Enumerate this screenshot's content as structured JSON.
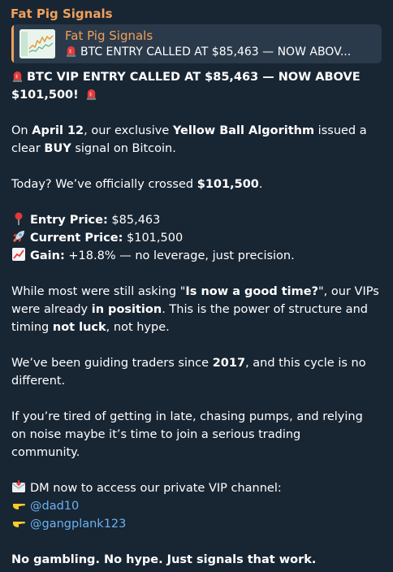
{
  "sender": "Fat Pig Signals",
  "reply": {
    "name": "Fat Pig Signals",
    "text": "BTC ENTRY CALLED AT $85,463 — NOW ABOV..."
  },
  "headline_1": "BTC VIP ENTRY CALLED AT $85,463 — NOW ABOVE",
  "headline_2": "$101,500!",
  "para1": {
    "a": "On ",
    "b": "April 12",
    "c": ", our exclusive ",
    "d": "Yellow Ball Algorithm",
    "e": " issued a",
    "f": "clear ",
    "g": "BUY",
    "h": " signal on Bitcoin."
  },
  "para2": {
    "a": "Today? We’ve officially crossed ",
    "b": "$101,500",
    "c": "."
  },
  "entry": {
    "label": "Entry Price:",
    "value": " $85,463"
  },
  "current": {
    "label": "Current Price:",
    "value": " $101,500"
  },
  "gain": {
    "label": "Gain:",
    "value": " +18.8% — no leverage, just precision."
  },
  "para3": {
    "l1a": "While most were still asking \"",
    "l1b": "Is now a good time?",
    "l1c": "\", our VIPs",
    "l2a": "were already ",
    "l2b": "in position",
    "l2c": ". This is the power of structure and",
    "l3a": "timing  ",
    "l3b": "not luck",
    "l3c": ", not hype."
  },
  "para4": {
    "l1a": "We’ve been guiding traders since ",
    "l1b": "2017",
    "l1c": ", and this cycle is no",
    "l2": "different."
  },
  "para5": {
    "l1": "If you’re tired of getting in late, chasing pumps, and relying",
    "l2": "on noise  maybe it’s time to join a serious trading",
    "l3": "community."
  },
  "dm": "DM now to access our private VIP channel:",
  "handles": [
    "@dad10",
    "@gangplank123"
  ],
  "closing": "No gambling. No hype. Just signals that work.",
  "colors": {
    "accent": "#f2a05b",
    "link": "#6ab2f2",
    "bubble": "#182533"
  },
  "icons": [
    "siren-icon",
    "pin-icon",
    "rocket-icon",
    "chart-up-icon",
    "envelope-icon",
    "pointing-hand-icon"
  ]
}
